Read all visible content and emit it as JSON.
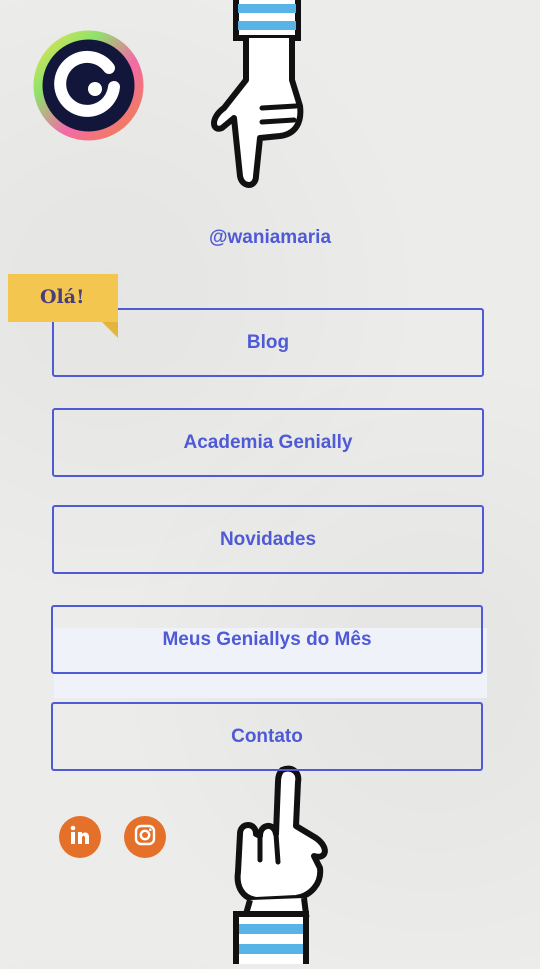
{
  "profile": {
    "username": "@waniamaria"
  },
  "badge": {
    "label": "Olá!"
  },
  "links": [
    {
      "label": "Blog"
    },
    {
      "label": "Academia Genially"
    },
    {
      "label": "Novidades"
    },
    {
      "label": "Meus Geniallys do Mês"
    },
    {
      "label": "Contato"
    }
  ],
  "social": [
    {
      "icon": "linkedin-icon"
    },
    {
      "icon": "instagram-icon"
    }
  ],
  "colors": {
    "accent": "#4f5ad6",
    "badge": "#f3c74f",
    "social": "#e4702a",
    "background": "#ececea"
  }
}
